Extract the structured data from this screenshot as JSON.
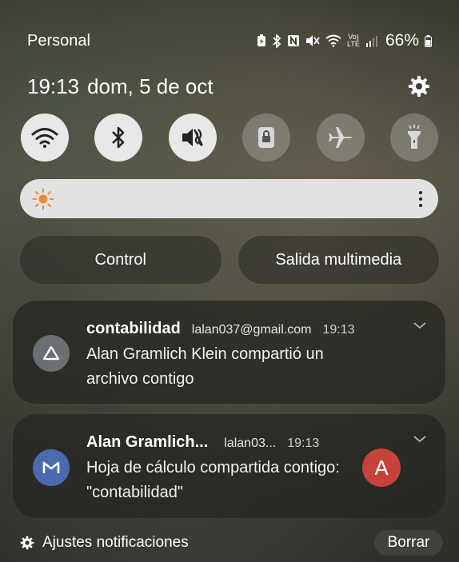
{
  "status_bar": {
    "carrier": "Personal",
    "network_label": "Vo) LTE",
    "battery_percent": "66%"
  },
  "header": {
    "time": "19:13",
    "date": "dom, 5 de oct"
  },
  "quick_toggles": [
    {
      "name": "wifi",
      "state": "on"
    },
    {
      "name": "bluetooth",
      "state": "on"
    },
    {
      "name": "mute",
      "state": "on"
    },
    {
      "name": "screen-lock-rotation",
      "state": "off"
    },
    {
      "name": "airplane-mode",
      "state": "off"
    },
    {
      "name": "flashlight",
      "state": "off"
    }
  ],
  "brightness": {
    "level": 0.0
  },
  "actions": {
    "control_label": "Control",
    "media_output_label": "Salida multimedia"
  },
  "notifications": [
    {
      "title": "contabilidad",
      "account": "lalan037@gmail.com",
      "time": "19:13",
      "body": "Alan Gramlich Klein compartió un archivo contigo",
      "app_icon": "google-drive-icon"
    },
    {
      "title": "Alan Gramlich...",
      "account": "lalan03...",
      "time": "19:13",
      "body": "Hoja de cálculo compartida contigo: \"contabilidad\"",
      "app_icon": "gmail-icon",
      "avatar_letter": "A"
    }
  ],
  "footer": {
    "settings_label": "Ajustes notificaciones",
    "clear_label": "Borrar"
  },
  "colors": {
    "toggle_on": "#e8e8e8",
    "avatar": "#c8423c",
    "gmail_icon_bg": "#4a6bb0",
    "drive_icon_bg": "#6c6f73",
    "sun": "#f08a3c"
  }
}
